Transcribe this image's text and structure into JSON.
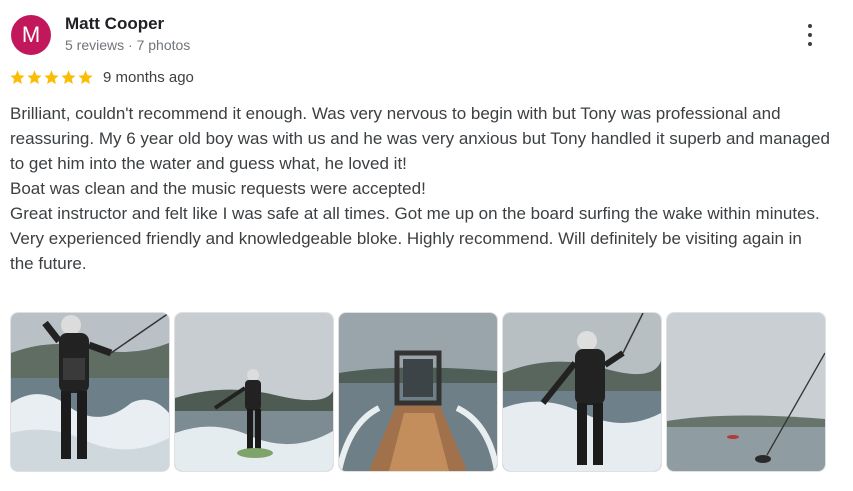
{
  "reviewer": {
    "initial": "M",
    "name": "Matt Cooper",
    "meta": "5 reviews · 7 photos",
    "avatar_color": "#c2185b"
  },
  "rating": {
    "stars": 5,
    "time": "9 months ago",
    "star_color": "#fbbc04"
  },
  "review_lines": [
    "Brilliant, couldn't recommend it enough. Was very nervous to begin with but Tony was professional and reassuring. My 6 year old boy was with us and he was very anxious but Tony handled it superb and managed to get him into the water and guess what, he loved it!",
    "Boat was clean and the music requests were accepted!",
    "Great instructor and felt like I was safe at all times. Got me up on the board surfing the wake within minutes.",
    "Very experienced friendly and knowledgeable bloke. Highly recommend. Will definitely be visiting again in the future."
  ],
  "photos": [
    "wakeboard-photo-1",
    "wakeboard-photo-2",
    "boat-photo",
    "wakeboard-photo-3",
    "lake-tow-photo"
  ],
  "icons": {
    "more": "more-vert-icon",
    "star": "star-icon"
  }
}
